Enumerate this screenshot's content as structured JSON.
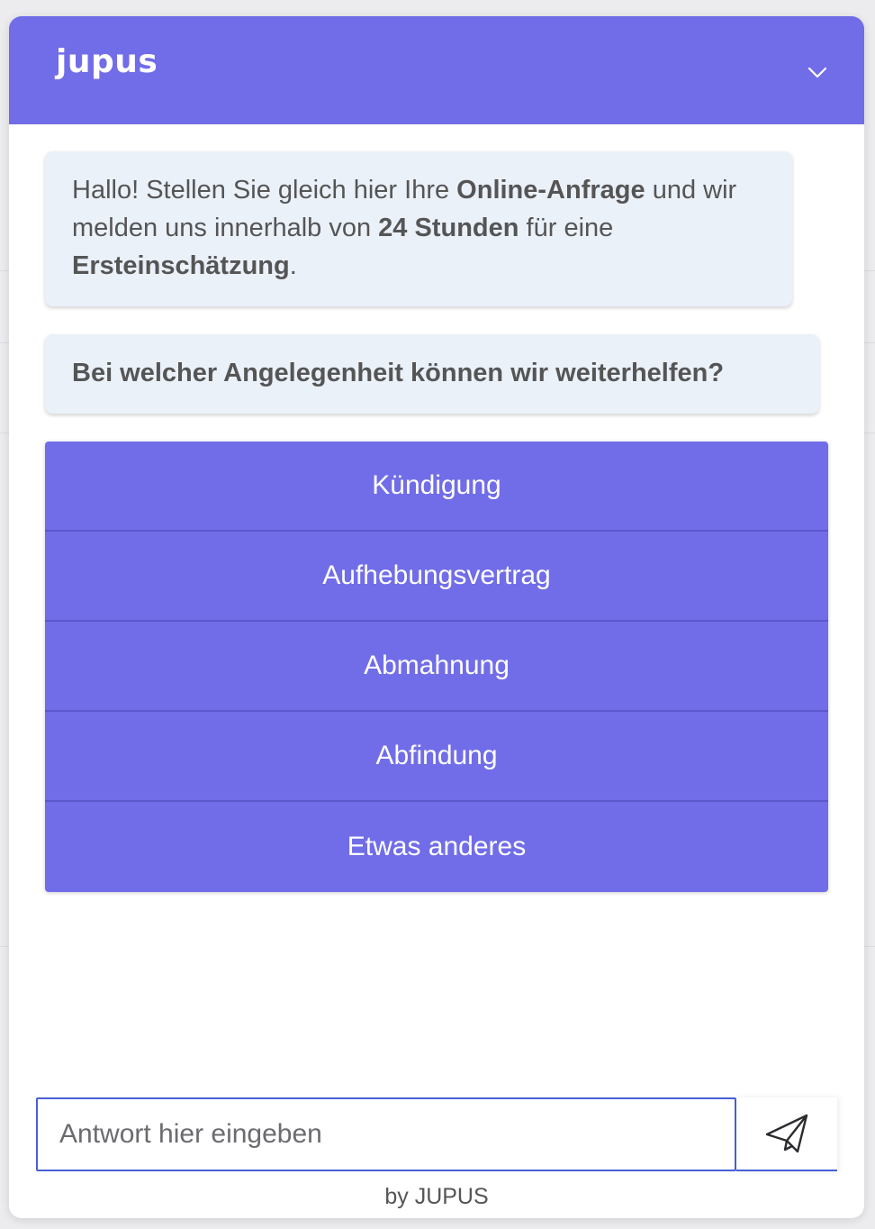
{
  "header": {
    "logo_text": "jupus"
  },
  "messages": {
    "greeting": {
      "part1": "Hallo! Stellen Sie gleich hier Ihre ",
      "bold1": "Online-Anfrage",
      "part2": " und wir melden uns innerhalb von ",
      "bold2": "24 Stunden",
      "part3": " für eine ",
      "bold3": "Ersteinschätzung",
      "part4": "."
    },
    "question": "Bei welcher Angelegenheit können wir weiterhelfen?"
  },
  "options": [
    {
      "label": "Kündigung"
    },
    {
      "label": "Aufhebungsvertrag"
    },
    {
      "label": "Abmahnung"
    },
    {
      "label": "Abfindung"
    },
    {
      "label": "Etwas anderes"
    }
  ],
  "composer": {
    "placeholder": "Antwort hier eingeben",
    "value": ""
  },
  "footer": {
    "text": "by JUPUS"
  },
  "icons": {
    "collapse": "chevron-down-icon",
    "send": "paper-plane-icon"
  },
  "colors": {
    "accent": "#716de8",
    "bubble_bg": "#ebf1f9",
    "input_border": "#4a5fd6"
  }
}
